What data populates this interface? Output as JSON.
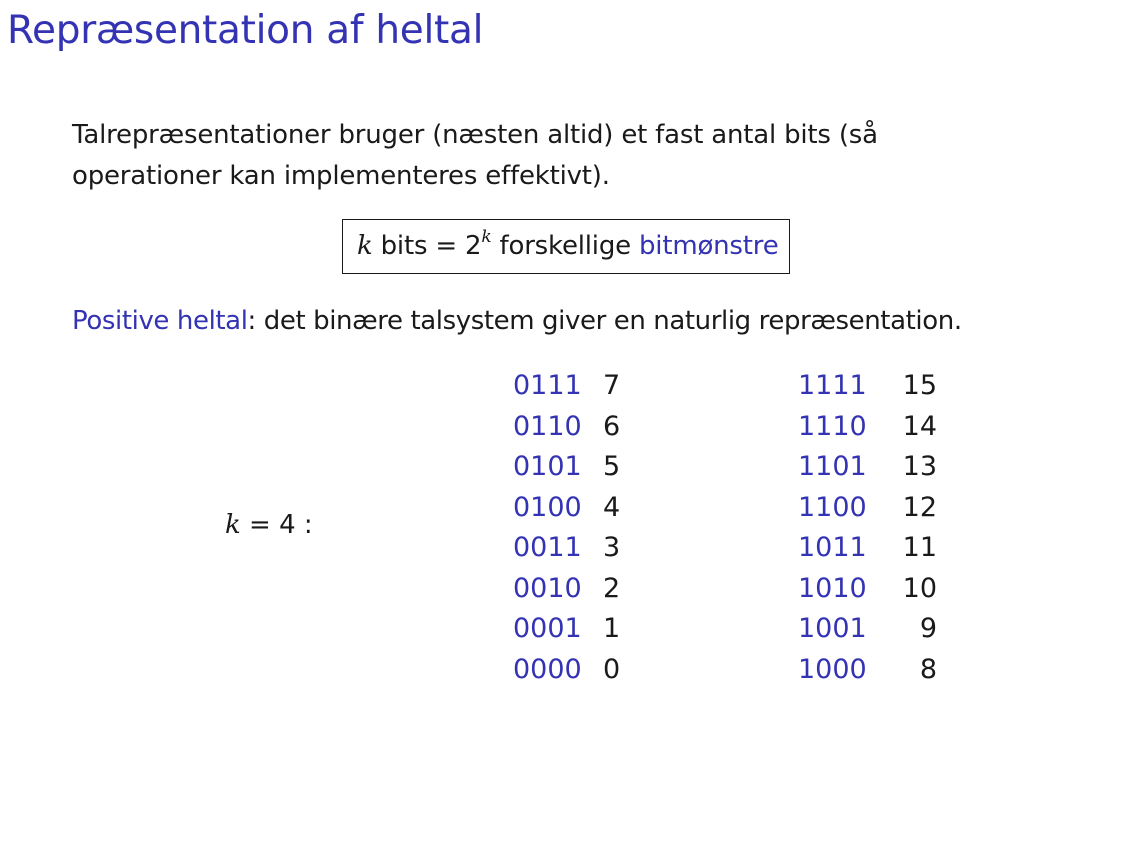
{
  "title": "Repræsentation af heltal",
  "intro": {
    "line1": "Talrepræsentationer bruger (næsten altid) et fast antal bits (så",
    "line2": "operationer kan implementeres effektivt)."
  },
  "box": {
    "var": "k",
    "text1": " bits = 2",
    "exp": "k",
    "text2": " forskellige ",
    "highlight": "bitmønstre"
  },
  "positive": {
    "label": "Positive heltal",
    "rest": ": det binære talsystem giver en naturlig repræsentation."
  },
  "k_label": {
    "var": "k",
    "rest": " = 4 :"
  },
  "left_table": [
    {
      "bits": "0111",
      "value": "7"
    },
    {
      "bits": "0110",
      "value": "6"
    },
    {
      "bits": "0101",
      "value": "5"
    },
    {
      "bits": "0100",
      "value": "4"
    },
    {
      "bits": "0011",
      "value": "3"
    },
    {
      "bits": "0010",
      "value": "2"
    },
    {
      "bits": "0001",
      "value": "1"
    },
    {
      "bits": "0000",
      "value": "0"
    }
  ],
  "right_table": [
    {
      "bits": "1111",
      "value": "15"
    },
    {
      "bits": "1110",
      "value": "14"
    },
    {
      "bits": "1101",
      "value": "13"
    },
    {
      "bits": "1100",
      "value": "12"
    },
    {
      "bits": "1011",
      "value": "11"
    },
    {
      "bits": "1010",
      "value": "10"
    },
    {
      "bits": "1001",
      "value": "9"
    },
    {
      "bits": "1000",
      "value": "8"
    }
  ],
  "colors": {
    "accent": "#3333b3",
    "text": "#1a1a1a"
  }
}
